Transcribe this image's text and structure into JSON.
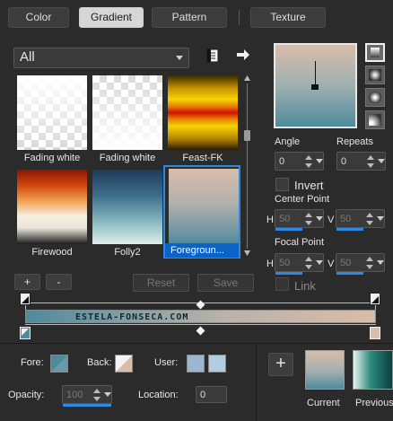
{
  "tabs": [
    {
      "label": "Color"
    },
    {
      "label": "Gradient"
    },
    {
      "label": "Pattern"
    },
    {
      "label": "Texture"
    }
  ],
  "category": {
    "value": "All"
  },
  "thumbnails": [
    {
      "label": "Fading white"
    },
    {
      "label": "Fading white"
    },
    {
      "label": "Feast-FK"
    },
    {
      "label": "Firewood"
    },
    {
      "label": "Folly2"
    },
    {
      "label": "Foregroun..."
    }
  ],
  "list_buttons": {
    "add": "+",
    "remove": "-",
    "reset": "Reset",
    "save": "Save"
  },
  "angle": {
    "label": "Angle",
    "value": "0"
  },
  "repeats": {
    "label": "Repeats",
    "value": "0"
  },
  "invert": {
    "label": "Invert"
  },
  "center_point": {
    "label": "Center Point",
    "h_label": "H",
    "h_value": "50",
    "v_label": "V",
    "v_value": "50"
  },
  "focal_point": {
    "label": "Focal Point",
    "h_label": "H",
    "h_value": "50",
    "v_label": "V",
    "v_value": "50"
  },
  "link": {
    "label": "Link"
  },
  "gradient_bar": {
    "text": "ESTELA-FONSECA.COM"
  },
  "bottom": {
    "fore_label": "Fore:",
    "back_label": "Back:",
    "user_label": "User:",
    "opacity_label": "Opacity:",
    "opacity_value": "100",
    "location_label": "Location:",
    "location_value": "0",
    "current_label": "Current",
    "previous_label": "Previous",
    "plus": "+"
  },
  "colors": {
    "accent": "#2b8be0",
    "gradient_start": "#4f8a9b",
    "gradient_end": "#d8bda9"
  }
}
